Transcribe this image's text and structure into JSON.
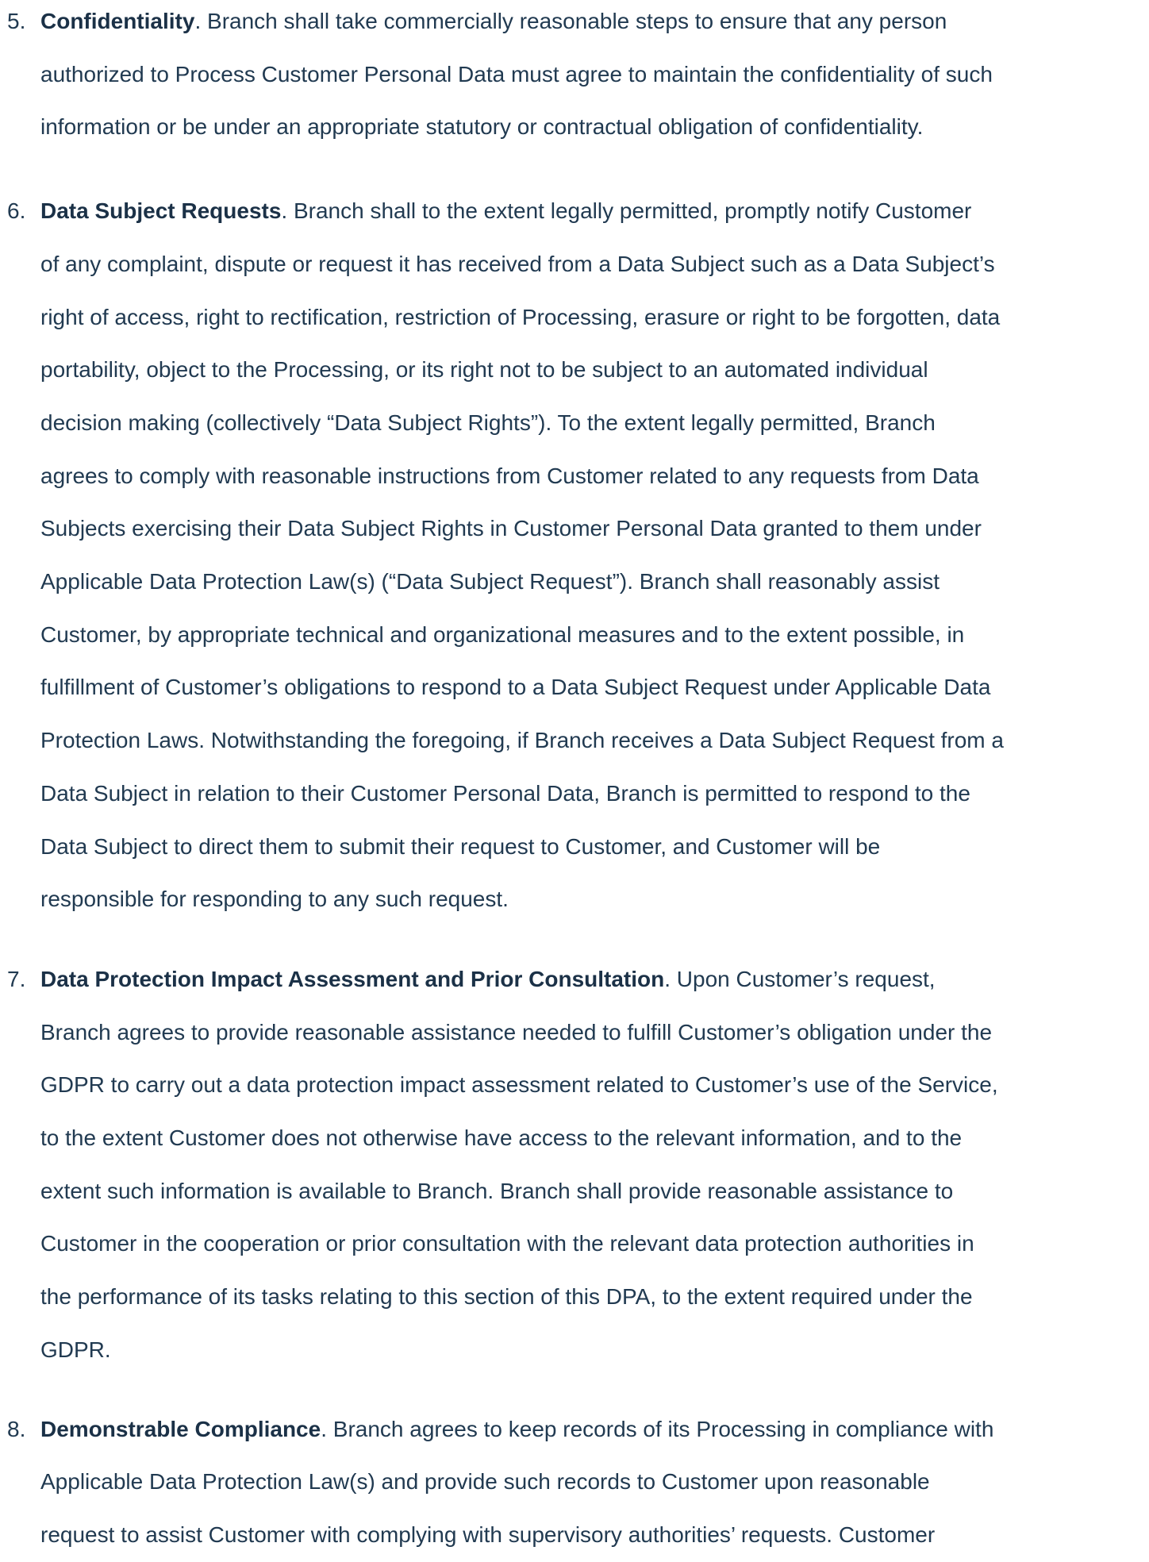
{
  "clauses": [
    {
      "number": "5.",
      "title": "Confidentiality",
      "lines": [
        ". Branch shall take commercially reasonable steps to ensure that any person",
        "authorized to Process Customer Personal Data must agree to maintain the confidentiality of such",
        "information or be under an appropriate statutory or contractual obligation of confidentiality."
      ]
    },
    {
      "number": "6.",
      "title": "Data Subject Requests",
      "lines": [
        ". Branch shall to the extent legally permitted, promptly notify Customer",
        "of any complaint, dispute or request it has received from a Data Subject such as a Data Subject’s",
        "right of access, right to rectification, restriction of Processing, erasure or right to be forgotten, data",
        "portability, object to the Processing, or its right not to be subject to an automated individual",
        "decision making (collectively “Data Subject Rights”). To the extent legally permitted, Branch",
        "agrees to comply with reasonable instructions from Customer related to any requests from Data",
        "Subjects exercising their Data Subject Rights in Customer Personal Data granted to them under",
        "Applicable Data Protection Law(s) (“Data Subject Request”). Branch shall reasonably assist",
        "Customer, by appropriate technical and organizational measures and to the extent possible, in",
        "fulfillment of Customer’s obligations to respond to a Data Subject Request under Applicable Data",
        "Protection Laws. Notwithstanding the foregoing, if Branch receives a Data Subject Request from a",
        "Data Subject in relation to their Customer Personal Data, Branch is permitted to respond to the",
        "Data Subject to direct them to submit their request to Customer, and Customer will be",
        "responsible for responding to any such request."
      ]
    },
    {
      "number": "7.",
      "title": "Data Protection Impact Assessment and Prior Consultation",
      "lines": [
        ". Upon Customer’s request,",
        "Branch agrees to provide reasonable assistance needed to fulfill Customer’s obligation under the",
        "GDPR to carry out a data protection impact assessment related to Customer’s use of the Service,",
        "to the extent Customer does not otherwise have access to the relevant information, and to the",
        "extent such information is available to Branch. Branch shall provide reasonable assistance to",
        "Customer in the cooperation or prior consultation with the relevant data protection authorities in",
        "the performance of its tasks relating to this section of this DPA, to the extent required under the",
        "GDPR."
      ]
    },
    {
      "number": "8.",
      "title": "Demonstrable Compliance",
      "lines": [
        ". Branch agrees to keep records of its Processing in compliance with",
        "Applicable Data Protection Law(s) and provide such records to Customer upon reasonable",
        "request to assist Customer with complying with supervisory authorities’ requests. Customer"
      ]
    }
  ]
}
